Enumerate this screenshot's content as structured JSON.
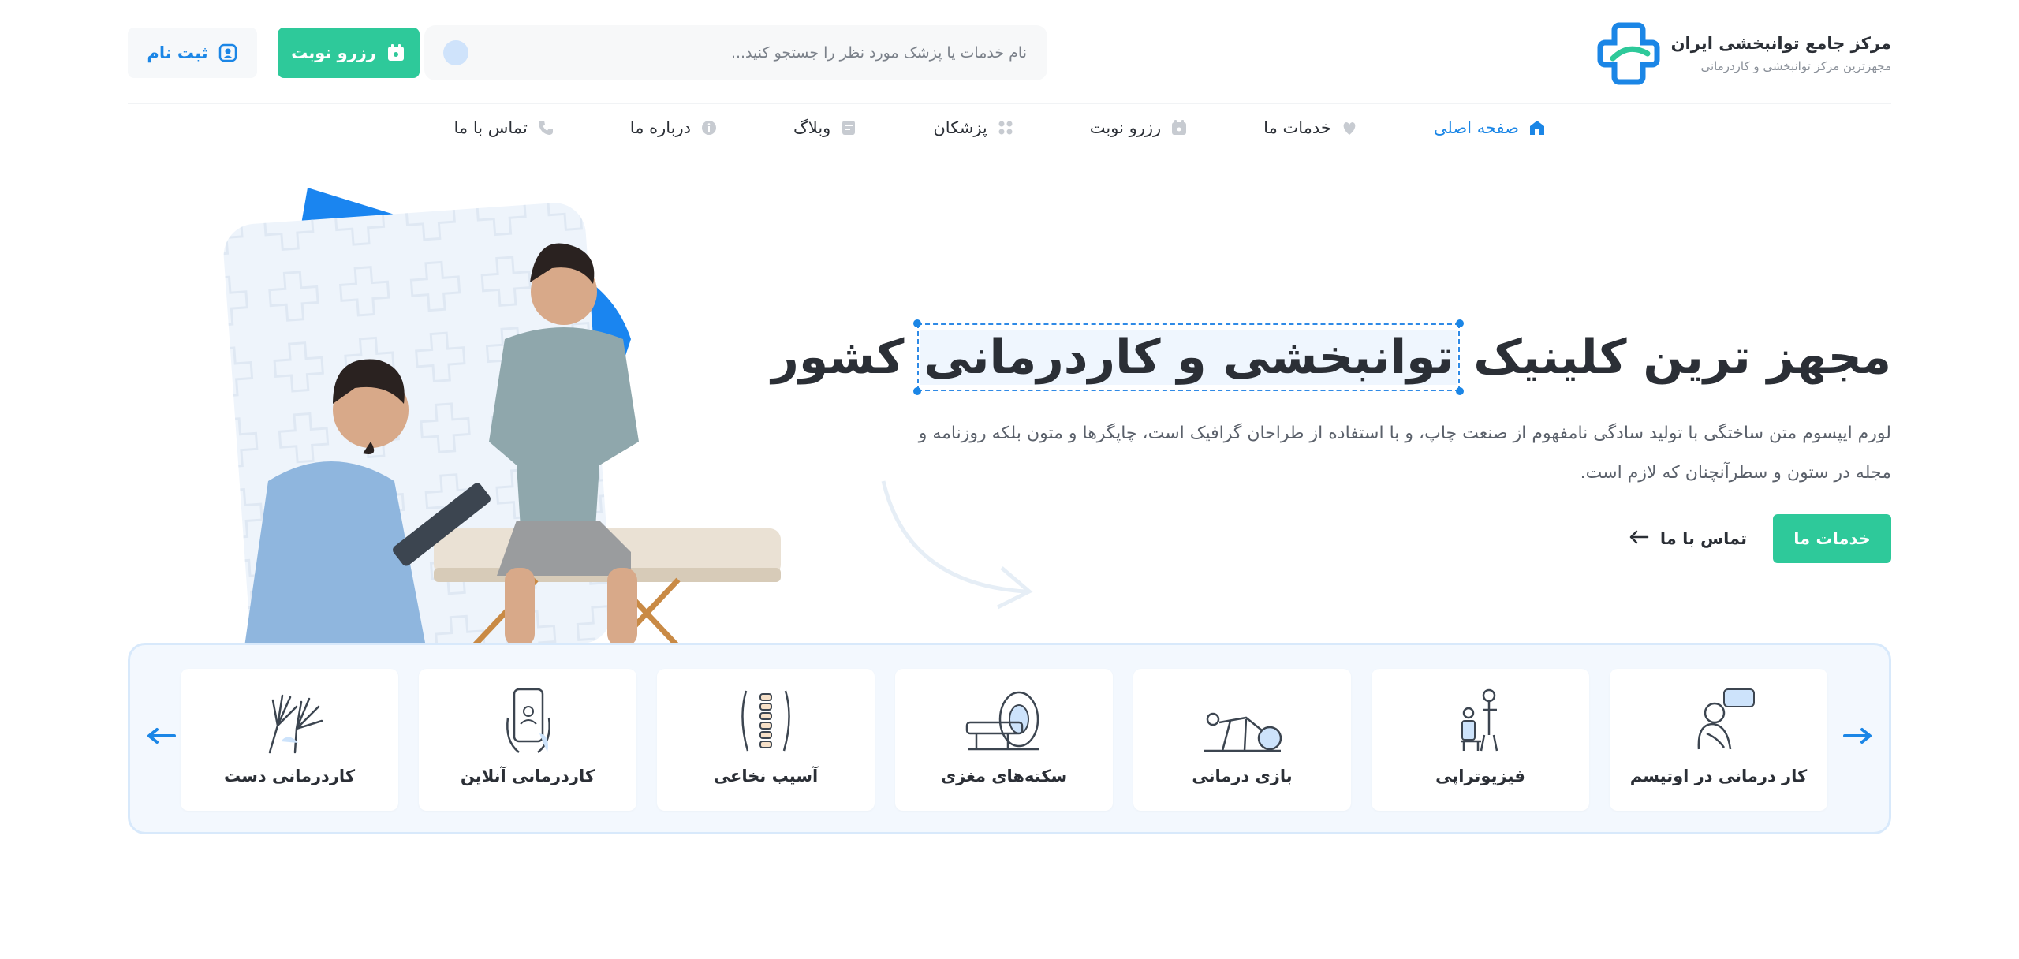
{
  "header": {
    "logo_title": "مرکز جامع توانبخشی ایران",
    "logo_subtitle": "مجهزترین مرکز توانبخشی و کاردرمانی",
    "search_placeholder": "نام خدمات یا پزشک مورد نظر را جستجو کنید...",
    "reserve_label": "رزرو نوبت",
    "signup_label": "ثبت نام"
  },
  "nav": {
    "items": [
      {
        "label": "صفحه اصلی",
        "icon": "home-icon",
        "active": true
      },
      {
        "label": "خدمات ما",
        "icon": "services-icon"
      },
      {
        "label": "رزرو نوبت",
        "icon": "calendar-icon"
      },
      {
        "label": "پزشکان",
        "icon": "doctors-icon"
      },
      {
        "label": "وبلاگ",
        "icon": "blog-icon"
      },
      {
        "label": "درباره ما",
        "icon": "info-icon"
      },
      {
        "label": "تماس با ما",
        "icon": "phone-icon"
      }
    ]
  },
  "hero": {
    "title_part1": "مجهز ترین کلینیک",
    "title_highlight": "توانبخشی و کاردرمانی",
    "title_part2": "کشور",
    "description": "لورم ایپسوم متن ساختگی با تولید سادگی نامفهوم از صنعت چاپ، و با استفاده از طراحان گرافیک است، چاپگرها و متون بلکه روزنامه و مجله در ستون و سطرآنچنان که لازم است.",
    "services_button": "خدمات ما",
    "contact_button": "تماس با ما"
  },
  "services": {
    "items": [
      {
        "label": "کار درمانی در اوتیسم",
        "icon": "autism-icon"
      },
      {
        "label": "فیزیوتراپی",
        "icon": "physiotherapy-icon"
      },
      {
        "label": "بازی درمانی",
        "icon": "play-therapy-icon"
      },
      {
        "label": "سکته‌های مغزی",
        "icon": "mri-scanner-icon"
      },
      {
        "label": "آسیب نخاعی",
        "icon": "spine-icon"
      },
      {
        "label": "کاردرمانی آنلاین",
        "icon": "online-phone-icon"
      },
      {
        "label": "کاردرمانی دست",
        "icon": "hand-icon"
      }
    ]
  },
  "colors": {
    "accent_green": "#2ec99a",
    "accent_blue": "#1b86e6",
    "text_dark": "#2b2f36"
  }
}
